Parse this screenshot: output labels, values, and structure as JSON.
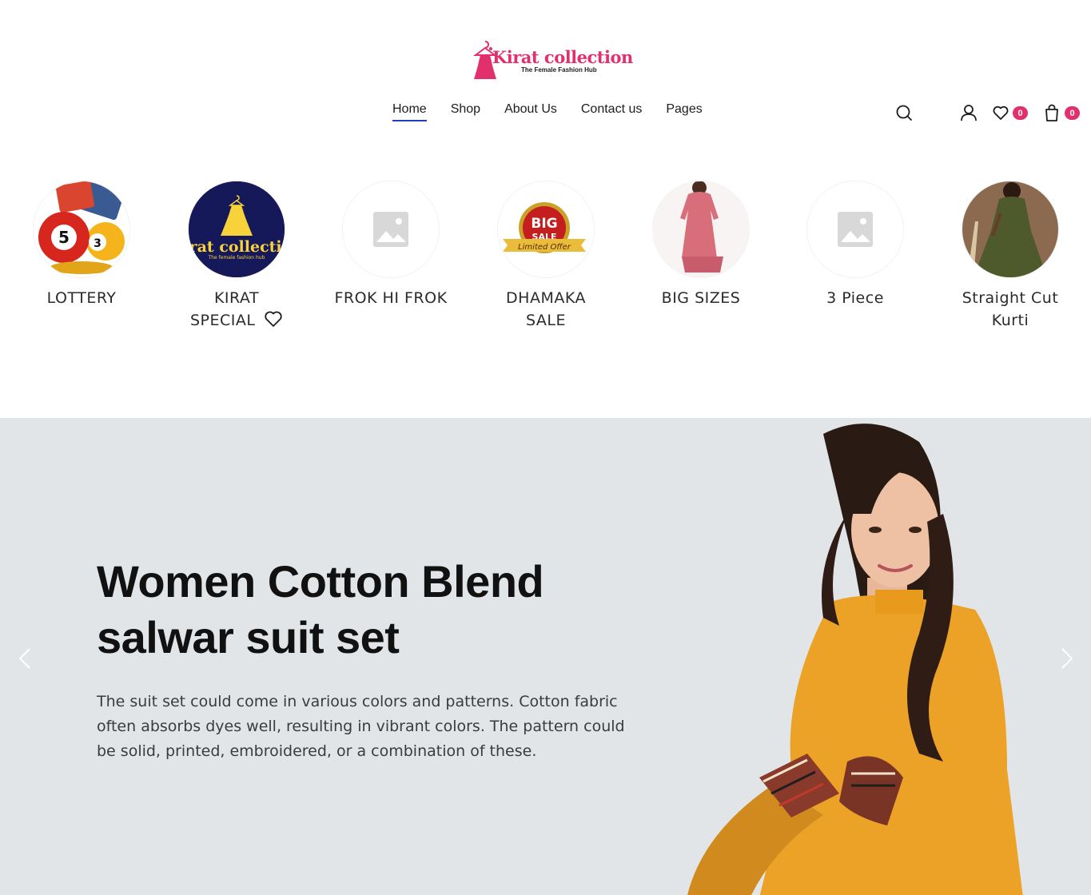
{
  "brand": {
    "name": "Kirat collection",
    "tagline": "The Female Fashion Hub",
    "accent": "#e1306c",
    "nav_underline": "#1f3fb8"
  },
  "nav": {
    "items": [
      {
        "label": "Home",
        "active": true
      },
      {
        "label": "Shop"
      },
      {
        "label": "About Us"
      },
      {
        "label": "Contact us"
      },
      {
        "label": "Pages"
      }
    ]
  },
  "header_icons": {
    "search": "search-icon",
    "account": "user-icon",
    "wishlist": "heart-icon",
    "wishlist_count": "0",
    "cart": "shopping-bag-icon",
    "cart_count": "0"
  },
  "categories": [
    {
      "label": "LOTTERY",
      "image": "lottery-balls"
    },
    {
      "label": "KIRAT SPECIAL",
      "line1": "KIRAT",
      "line2": "SPECIAL",
      "image": "kirat-logo",
      "icon": "heart-icon"
    },
    {
      "label": "FROK HI FROK",
      "image": "placeholder"
    },
    {
      "label": "DHAMAKA SALE",
      "line1": "DHAMAKA",
      "line2": "SALE",
      "image": "big-sale-badge",
      "badge_text1": "BIG",
      "badge_text2": "SALE",
      "badge_text3": "Limited Offer"
    },
    {
      "label": "BIG SIZES",
      "image": "pink-kurti"
    },
    {
      "label": "3 Piece",
      "image": "placeholder"
    },
    {
      "label": "Straight Cut Kurti",
      "line1": "Straight Cut",
      "line2": "Kurti",
      "image": "green-dress"
    }
  ],
  "hero": {
    "title_line1": "Women Cotton Blend",
    "title_line2": "salwar suit set",
    "description": "The suit set could come in various colors and patterns. Cotton fabric often absorbs dyes well, resulting in vibrant colors. The pattern could be solid, printed, embroidered, or a combination of these.",
    "background": "#e2e5e8",
    "prev_icon": "chevron-left-icon",
    "next_icon": "chevron-right-icon"
  }
}
